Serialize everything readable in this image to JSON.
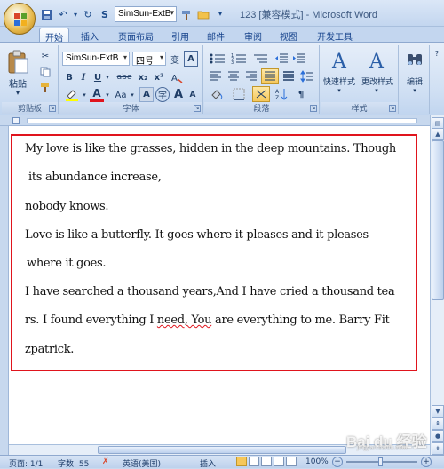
{
  "window": {
    "title": "123 [兼容模式] - Microsoft Word",
    "quick_access_font": "SimSun-ExtB"
  },
  "tabs": [
    {
      "label": "开始",
      "active": true
    },
    {
      "label": "插入"
    },
    {
      "label": "页面布局"
    },
    {
      "label": "引用"
    },
    {
      "label": "邮件"
    },
    {
      "label": "审阅"
    },
    {
      "label": "视图"
    },
    {
      "label": "开发工具"
    }
  ],
  "ribbon": {
    "clipboard": {
      "label": "剪贴板",
      "paste_label": "粘贴"
    },
    "font": {
      "label": "字体",
      "font_name": "SimSun-ExtB",
      "font_size": "四号",
      "bold": "B",
      "italic": "I",
      "underline": "U",
      "strike": "abe",
      "subscript": "x₂",
      "superscript": "x²",
      "font_color_letter": "A",
      "change_case": "Aa",
      "phonetic": "变",
      "char_border": "A",
      "grow": "A",
      "shrink": "A"
    },
    "paragraph": {
      "label": "段落"
    },
    "styles": {
      "label": "样式",
      "quick_styles": "快速样式",
      "change_styles": "更改样式"
    },
    "editing": {
      "label": "编辑"
    }
  },
  "document": {
    "lines": [
      "My love is like the grasses, hidden in the deep mountains. Though",
      "its abundance increase,",
      "nobody knows.",
      " Love is like a butterfly. It goes where it pleases and it pleases",
      "where it goes.",
      " I have searched a thousand years,And I have cried a thousand tea",
      "zpatrick."
    ],
    "line7_before": "rs. I found everything I ",
    "line7_misspelled": "need, You",
    "line7_after": " are everything to me. Barry Fit"
  },
  "status": {
    "page": "页面: 1/1",
    "words": "字数: 55",
    "language": "英语(美国)",
    "insert_mode": "插入",
    "zoom": "100%"
  },
  "watermark": {
    "brand": "Bai du 经验",
    "url": "jingyan.baidu.com"
  },
  "colors": {
    "selection_border": "#e0141d",
    "ribbon_bg": "#cfdff3",
    "title_text": "#3e5a82"
  }
}
